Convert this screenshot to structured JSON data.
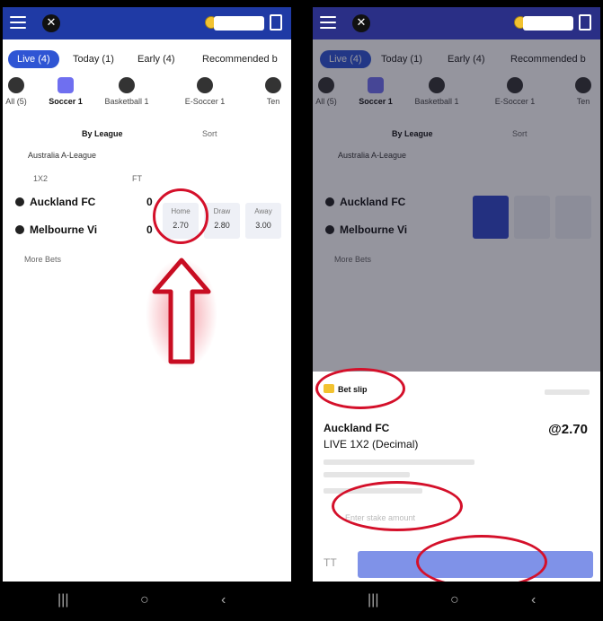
{
  "header": {
    "logo_text": "✕"
  },
  "tabs": [
    {
      "label": "Live (4)",
      "active": true
    },
    {
      "label": "Today (1)",
      "active": false
    },
    {
      "label": "Early (4)",
      "active": false
    },
    {
      "label": "Recommended b",
      "active": false
    }
  ],
  "sports": [
    {
      "label": "All (5)",
      "icon": "all-sports-icon"
    },
    {
      "label": "Soccer 1",
      "icon": "soccer-icon",
      "active": true
    },
    {
      "label": "Basketball 1",
      "icon": "basketball-icon"
    },
    {
      "label": "E-Soccer 1",
      "icon": "esoccer-icon"
    },
    {
      "label": "Ten",
      "icon": "tennis-icon"
    }
  ],
  "filter": {
    "left": "By League",
    "right": "Sort"
  },
  "league": {
    "name": "Australia A-League",
    "header_1x2": "1X2",
    "header_ft": "FT"
  },
  "match": {
    "home": "Auckland FC",
    "away": "Melbourne Vi",
    "home_score": "0",
    "away_score": "0",
    "odds_labels": [
      "Home",
      "Draw",
      "Away"
    ],
    "odds": [
      "2.70",
      "2.80",
      "3.00"
    ],
    "more_bets": "More Bets"
  },
  "betslip": {
    "header": "Bet slip",
    "selection": "Auckland FC",
    "market": "LIVE 1X2 (Decimal)",
    "odds": "@2.70",
    "stake_placeholder": "Enter stake amount",
    "quick": "TT"
  },
  "colors": {
    "brand": "#1f3aa5",
    "accent": "#2f55d4",
    "annotation": "#d4102a"
  }
}
